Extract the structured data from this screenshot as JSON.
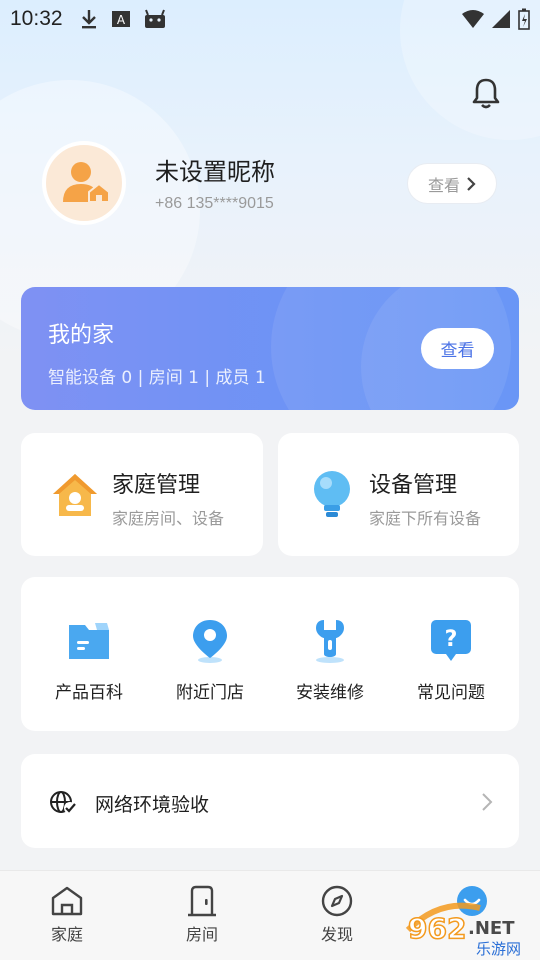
{
  "status_bar": {
    "time": "10:32"
  },
  "profile": {
    "nickname": "未设置昵称",
    "phone": "+86 135****9015",
    "view_label": "查看"
  },
  "home_card": {
    "title": "我的家",
    "stats": "智能设备 0 | 房间 1 | 成员 1",
    "view_label": "查看"
  },
  "management": [
    {
      "title": "家庭管理",
      "subtitle": "家庭房间、设备",
      "icon": "house-icon"
    },
    {
      "title": "设备管理",
      "subtitle": "家庭下所有设备",
      "icon": "bulb-icon"
    }
  ],
  "services": [
    {
      "label": "产品百科",
      "icon": "folder-icon"
    },
    {
      "label": "附近门店",
      "icon": "location-pin-icon"
    },
    {
      "label": "安装维修",
      "icon": "wrench-icon"
    },
    {
      "label": "常见问题",
      "icon": "question-chat-icon"
    }
  ],
  "network": {
    "label": "网络环境验收",
    "icon": "globe-check-icon"
  },
  "tabs": [
    {
      "label": "家庭",
      "icon": "home-tab-icon"
    },
    {
      "label": "房间",
      "icon": "door-tab-icon"
    },
    {
      "label": "发现",
      "icon": "compass-tab-icon"
    }
  ],
  "watermark": {
    "text_main": "962.NET",
    "text_sub": "乐游网"
  },
  "colors": {
    "home_card_gradient_start": "#7f91f3",
    "home_card_gradient_end": "#5d8ef6",
    "view_button_text": "#4a72e6",
    "avatar_bg": "#fbe9d7",
    "avatar_icon": "#f5a347"
  }
}
